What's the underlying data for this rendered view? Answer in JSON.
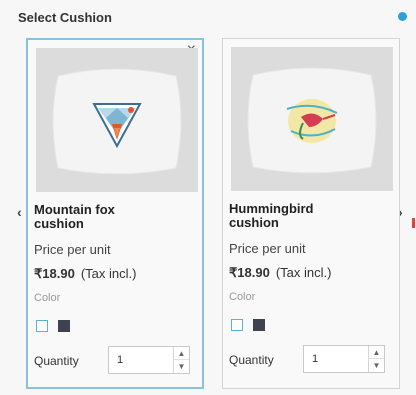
{
  "header": {
    "title": "Select Cushion"
  },
  "nav": {
    "prev": "‹",
    "next": "›"
  },
  "cards": [
    {
      "name": "Mountain fox\ncushion",
      "price_label": "Price per unit",
      "price": "₹18.90",
      "tax_note": "(Tax incl.)",
      "color_label": "Color",
      "colors": [
        "#ffffff",
        "#3d4450"
      ],
      "quantity_label": "Quantity",
      "quantity": "1",
      "selected": true,
      "close": "×"
    },
    {
      "name": "Hummingbird\ncushion",
      "price_label": "Price per unit",
      "price": "₹18.90",
      "tax_note": "(Tax incl.)",
      "color_label": "Color",
      "colors": [
        "#ffffff",
        "#3d4450"
      ],
      "quantity_label": "Quantity",
      "quantity": "1",
      "selected": false
    }
  ],
  "colors": {
    "accent": "#2f9fd6",
    "selected_border": "#86c3dd"
  },
  "icons": {
    "close": "close-icon",
    "up": "chevron-up-icon",
    "down": "chevron-down-icon",
    "info": "info-dot-icon"
  }
}
